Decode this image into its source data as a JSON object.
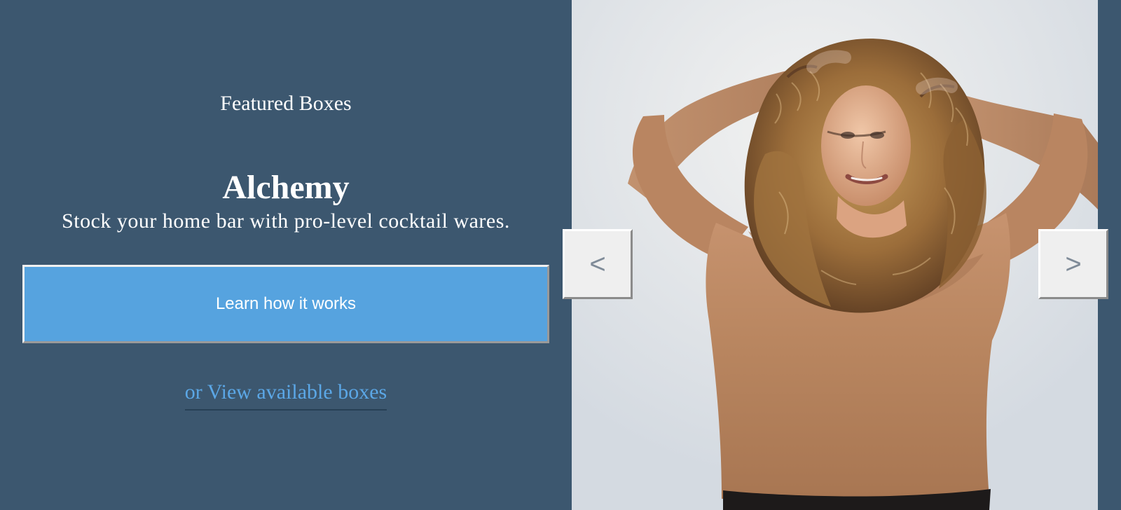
{
  "featured": {
    "eyebrow": "Featured Boxes",
    "title": "Alchemy",
    "subtitle": "Stock your home bar with pro-level cocktail wares.",
    "cta_label": "Learn how it works",
    "secondary_link": "or View available boxes"
  },
  "carousel": {
    "prev_label": "<",
    "next_label": ">",
    "image_icon": "featured-product-photo"
  },
  "colors": {
    "background": "#3c576f",
    "cta": "#56a3df",
    "link": "#5ba7e6",
    "photo_background": "#dfe3e7"
  }
}
